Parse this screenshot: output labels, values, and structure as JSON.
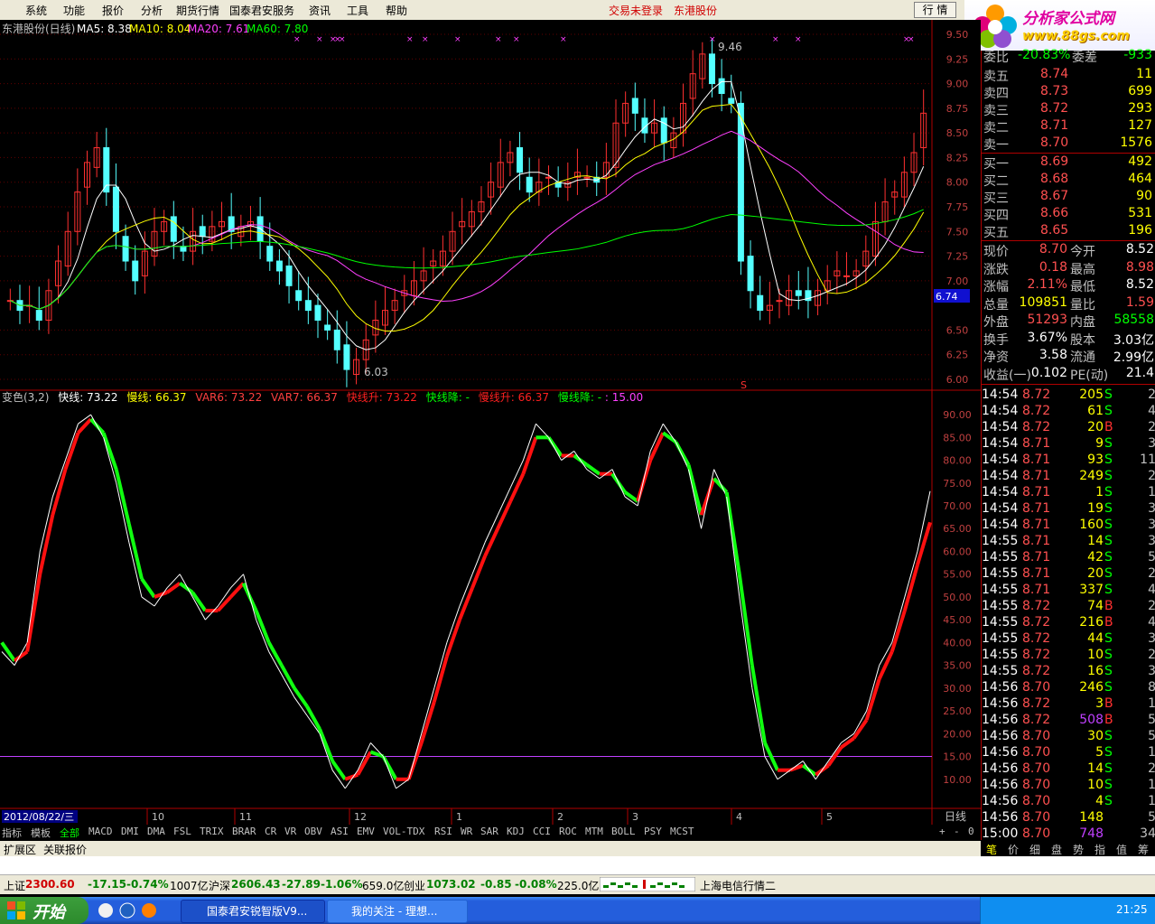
{
  "menu": {
    "items": [
      "系统",
      "功能",
      "报价",
      "分析",
      "期货行情",
      "国泰君安服务",
      "资讯",
      "工具",
      "帮助"
    ],
    "login_status": "交易未登录",
    "stock_name": "东港股份",
    "trade_button": "行 情"
  },
  "logo": {
    "text": "分析家公式网",
    "url": "www.88gs.com"
  },
  "main_chart": {
    "legend": {
      "title": "东港股份(日线)",
      "ma5": "MA5: 8.38",
      "ma10": "MA10: 8.04",
      "ma20": "MA20: 7.61",
      "ma60": "MA60: 7.80"
    },
    "y_ticks": [
      "9.50",
      "9.25",
      "9.00",
      "8.75",
      "8.50",
      "8.25",
      "8.00",
      "7.75",
      "7.50",
      "7.25",
      "7.00",
      "6.74",
      "6.50",
      "6.25",
      "6.00"
    ],
    "ylim": [
      6.0,
      9.5
    ],
    "high_label": "9.46",
    "low_label": "6.03",
    "current_price_tag": "6.74",
    "s_marker": "S"
  },
  "indicator": {
    "legend": {
      "name": "变色(3,2)",
      "fast": "快线: 73.22",
      "slow": "慢线: 66.37",
      "var6": "VAR6: 73.22",
      "var7": "VAR7: 66.37",
      "fast_up": "快线升: 73.22",
      "fast_down": "快线降: -",
      "slow_up": "慢线升: 66.37",
      "slow_down": "慢线降: -",
      "level": ": 15.00"
    },
    "y_ticks": [
      "90.00",
      "85.00",
      "80.00",
      "75.00",
      "70.00",
      "65.00",
      "60.00",
      "55.00",
      "50.00",
      "45.00",
      "40.00",
      "35.00",
      "30.00",
      "25.00",
      "20.00",
      "15.00",
      "10.00"
    ],
    "ylim": [
      5,
      92
    ],
    "threshold": 15
  },
  "x_axis": {
    "date_label": "2012/08/22/三",
    "months": [
      "10",
      "11",
      "12",
      "1",
      "2",
      "3",
      "4",
      "5"
    ],
    "period": "日线"
  },
  "chart_data": {
    "type": "line",
    "title": "东港股份(日线)",
    "price_ohlc_close": [
      6.8,
      6.7,
      6.75,
      6.6,
      6.9,
      7.2,
      7.5,
      7.9,
      8.2,
      8.35,
      7.9,
      7.5,
      7.2,
      7.0,
      7.3,
      7.5,
      7.6,
      7.4,
      7.3,
      7.5,
      7.45,
      7.55,
      7.6,
      7.5,
      7.55,
      7.6,
      7.4,
      7.2,
      7.1,
      6.95,
      6.8,
      6.7,
      6.6,
      6.5,
      6.3,
      6.1,
      6.2,
      6.4,
      6.6,
      6.7,
      6.8,
      6.9,
      7.0,
      7.1,
      7.2,
      7.3,
      7.5,
      7.6,
      7.7,
      7.8,
      8.0,
      8.2,
      8.3,
      8.1,
      7.9,
      8.0,
      8.05,
      7.95,
      8.0,
      8.1,
      8.05,
      8.0,
      8.2,
      8.6,
      8.8,
      8.7,
      8.5,
      8.6,
      8.4,
      8.5,
      8.8,
      9.1,
      9.3,
      9.0,
      8.9,
      8.8,
      7.2,
      6.9,
      6.7,
      6.75,
      6.8,
      6.9,
      6.85,
      6.8,
      6.9,
      7.0,
      7.1,
      7.05,
      7.1,
      7.3,
      7.6,
      7.8,
      7.9,
      8.1,
      8.3,
      8.7
    ],
    "ma5": 8.38,
    "ma10": 8.04,
    "ma20": 7.61,
    "ma60": 7.8,
    "indicator_fast": [
      38,
      35,
      40,
      60,
      72,
      80,
      88,
      90,
      85,
      75,
      62,
      50,
      48,
      52,
      55,
      50,
      45,
      48,
      52,
      55,
      45,
      38,
      33,
      28,
      24,
      20,
      12,
      8,
      12,
      18,
      15,
      8,
      10,
      20,
      30,
      40,
      48,
      55,
      62,
      68,
      74,
      80,
      88,
      85,
      80,
      82,
      78,
      76,
      78,
      72,
      70,
      82,
      88,
      84,
      78,
      65,
      78,
      72,
      50,
      30,
      15,
      10,
      12,
      14,
      10,
      14,
      18,
      20,
      25,
      35,
      40,
      50,
      60,
      73.22
    ],
    "indicator_slow": [
      40,
      36,
      38,
      55,
      68,
      78,
      86,
      89,
      86,
      78,
      66,
      54,
      50,
      51,
      53,
      51,
      47,
      47,
      50,
      53,
      47,
      40,
      35,
      30,
      26,
      21,
      14,
      10,
      11,
      16,
      15,
      10,
      10,
      18,
      27,
      37,
      45,
      52,
      59,
      65,
      71,
      77,
      85,
      85,
      81,
      81,
      79,
      77,
      77,
      73,
      71,
      80,
      86,
      84,
      79,
      68,
      76,
      73,
      55,
      35,
      18,
      12,
      12,
      13,
      11,
      13,
      17,
      19,
      23,
      32,
      38,
      47,
      57,
      66.37
    ]
  },
  "quote": {
    "ratio_label": "委比",
    "ratio": "-20.83%",
    "diff_label": "委差",
    "diff": "-933",
    "asks": [
      {
        "label": "卖五",
        "price": "8.74",
        "vol": "11"
      },
      {
        "label": "卖四",
        "price": "8.73",
        "vol": "699"
      },
      {
        "label": "卖三",
        "price": "8.72",
        "vol": "293"
      },
      {
        "label": "卖二",
        "price": "8.71",
        "vol": "127"
      },
      {
        "label": "卖一",
        "price": "8.70",
        "vol": "1576"
      }
    ],
    "bids": [
      {
        "label": "买一",
        "price": "8.69",
        "vol": "492"
      },
      {
        "label": "买二",
        "price": "8.68",
        "vol": "464"
      },
      {
        "label": "买三",
        "price": "8.67",
        "vol": "90"
      },
      {
        "label": "买四",
        "price": "8.66",
        "vol": "531"
      },
      {
        "label": "买五",
        "price": "8.65",
        "vol": "196"
      }
    ],
    "stats": [
      {
        "l1": "现价",
        "v1": "8.70",
        "c1": "#ff5050",
        "l2": "今开",
        "v2": "8.52",
        "c2": "#ffffff"
      },
      {
        "l1": "涨跌",
        "v1": "0.18",
        "c1": "#ff5050",
        "l2": "最高",
        "v2": "8.98",
        "c2": "#ff5050"
      },
      {
        "l1": "涨幅",
        "v1": "2.11%",
        "c1": "#ff5050",
        "l2": "最低",
        "v2": "8.52",
        "c2": "#ffffff"
      },
      {
        "l1": "总量",
        "v1": "109851",
        "c1": "#ffff00",
        "l2": "量比",
        "v2": "1.59",
        "c2": "#ff5050"
      },
      {
        "l1": "外盘",
        "v1": "51293",
        "c1": "#ff5050",
        "l2": "内盘",
        "v2": "58558",
        "c2": "#00ff00"
      },
      {
        "l1": "换手",
        "v1": "3.67%",
        "c1": "#ffffff",
        "l2": "股本",
        "v2": "3.03亿",
        "c2": "#ffffff"
      },
      {
        "l1": "净资",
        "v1": "3.58",
        "c1": "#ffffff",
        "l2": "流通",
        "v2": "2.99亿",
        "c2": "#ffffff"
      },
      {
        "l1": "收益(一)",
        "v1": "0.102",
        "c1": "#ffffff",
        "l2": "PE(动)",
        "v2": "21.4",
        "c2": "#ffffff"
      }
    ],
    "ticks": [
      {
        "t": "14:54",
        "p": "8.72",
        "v": "205",
        "s": "S",
        "n": "2"
      },
      {
        "t": "14:54",
        "p": "8.72",
        "v": "61",
        "s": "S",
        "n": "4"
      },
      {
        "t": "14:54",
        "p": "8.72",
        "v": "20",
        "s": "B",
        "n": "2"
      },
      {
        "t": "14:54",
        "p": "8.71",
        "v": "9",
        "s": "S",
        "n": "3"
      },
      {
        "t": "14:54",
        "p": "8.71",
        "v": "93",
        "s": "S",
        "n": "11"
      },
      {
        "t": "14:54",
        "p": "8.71",
        "v": "249",
        "s": "S",
        "n": "2"
      },
      {
        "t": "14:54",
        "p": "8.71",
        "v": "1",
        "s": "S",
        "n": "1"
      },
      {
        "t": "14:54",
        "p": "8.71",
        "v": "19",
        "s": "S",
        "n": "3"
      },
      {
        "t": "14:54",
        "p": "8.71",
        "v": "160",
        "s": "S",
        "n": "3"
      },
      {
        "t": "14:55",
        "p": "8.71",
        "v": "14",
        "s": "S",
        "n": "3"
      },
      {
        "t": "14:55",
        "p": "8.71",
        "v": "42",
        "s": "S",
        "n": "5"
      },
      {
        "t": "14:55",
        "p": "8.71",
        "v": "20",
        "s": "S",
        "n": "2"
      },
      {
        "t": "14:55",
        "p": "8.71",
        "v": "337",
        "s": "S",
        "n": "4"
      },
      {
        "t": "14:55",
        "p": "8.72",
        "v": "74",
        "s": "B",
        "n": "2"
      },
      {
        "t": "14:55",
        "p": "8.72",
        "v": "216",
        "s": "B",
        "n": "4"
      },
      {
        "t": "14:55",
        "p": "8.72",
        "v": "44",
        "s": "S",
        "n": "3"
      },
      {
        "t": "14:55",
        "p": "8.72",
        "v": "10",
        "s": "S",
        "n": "2"
      },
      {
        "t": "14:55",
        "p": "8.72",
        "v": "16",
        "s": "S",
        "n": "3"
      },
      {
        "t": "14:56",
        "p": "8.70",
        "v": "246",
        "s": "S",
        "n": "8"
      },
      {
        "t": "14:56",
        "p": "8.72",
        "v": "3",
        "s": "B",
        "n": "1"
      },
      {
        "t": "14:56",
        "p": "8.72",
        "v": "508",
        "s": "B",
        "n": "5"
      },
      {
        "t": "14:56",
        "p": "8.70",
        "v": "30",
        "s": "S",
        "n": "5"
      },
      {
        "t": "14:56",
        "p": "8.70",
        "v": "5",
        "s": "S",
        "n": "1"
      },
      {
        "t": "14:56",
        "p": "8.70",
        "v": "14",
        "s": "S",
        "n": "2"
      },
      {
        "t": "14:56",
        "p": "8.70",
        "v": "10",
        "s": "S",
        "n": "1"
      },
      {
        "t": "14:56",
        "p": "8.70",
        "v": "4",
        "s": "S",
        "n": "1"
      },
      {
        "t": "14:56",
        "p": "8.70",
        "v": "148",
        "s": "",
        "n": "5"
      },
      {
        "t": "15:00",
        "p": "8.70",
        "v": "748",
        "s": "",
        "n": "34"
      }
    ]
  },
  "indicator_tabs": [
    "指标",
    "模板",
    "全部",
    "MACD",
    "DMI",
    "DMA",
    "FSL",
    "TRIX",
    "BRAR",
    "CR",
    "VR",
    "OBV",
    "ASI",
    "EMV",
    "VOL-TDX",
    "RSI",
    "WR",
    "SAR",
    "KDJ",
    "CCI",
    "ROC",
    "MTM",
    "BOLL",
    "PSY",
    "MCST"
  ],
  "extra_tabs": [
    "扩展区",
    "关联报价"
  ],
  "right_tabs": [
    "笔",
    "价",
    "细",
    "盘",
    "势",
    "指",
    "值",
    "筹"
  ],
  "zoom_buttons": [
    "+",
    "-",
    "0"
  ],
  "status": {
    "sh_label": "上证",
    "sh_value": "2300.60",
    "sh_chg": "-17.15",
    "sh_pct": "-0.74%",
    "sh_amt": "1007亿",
    "hs_label": "沪深",
    "hs_value": "2606.43",
    "hs_chg": "-27.89",
    "hs_pct": "-1.06%",
    "hs_amt": "659.0亿",
    "cy_label": "创业",
    "cy_value": "1073.02",
    "cy_chg": "-0.85",
    "cy_pct": "-0.08%",
    "cy_amt": "225.0亿",
    "server": "上海电信行情二"
  },
  "taskbar": {
    "start": "开始",
    "task1": "国泰君安锐智版V9...",
    "task2": "我的关注 - 理想...",
    "clock": "21:25"
  }
}
